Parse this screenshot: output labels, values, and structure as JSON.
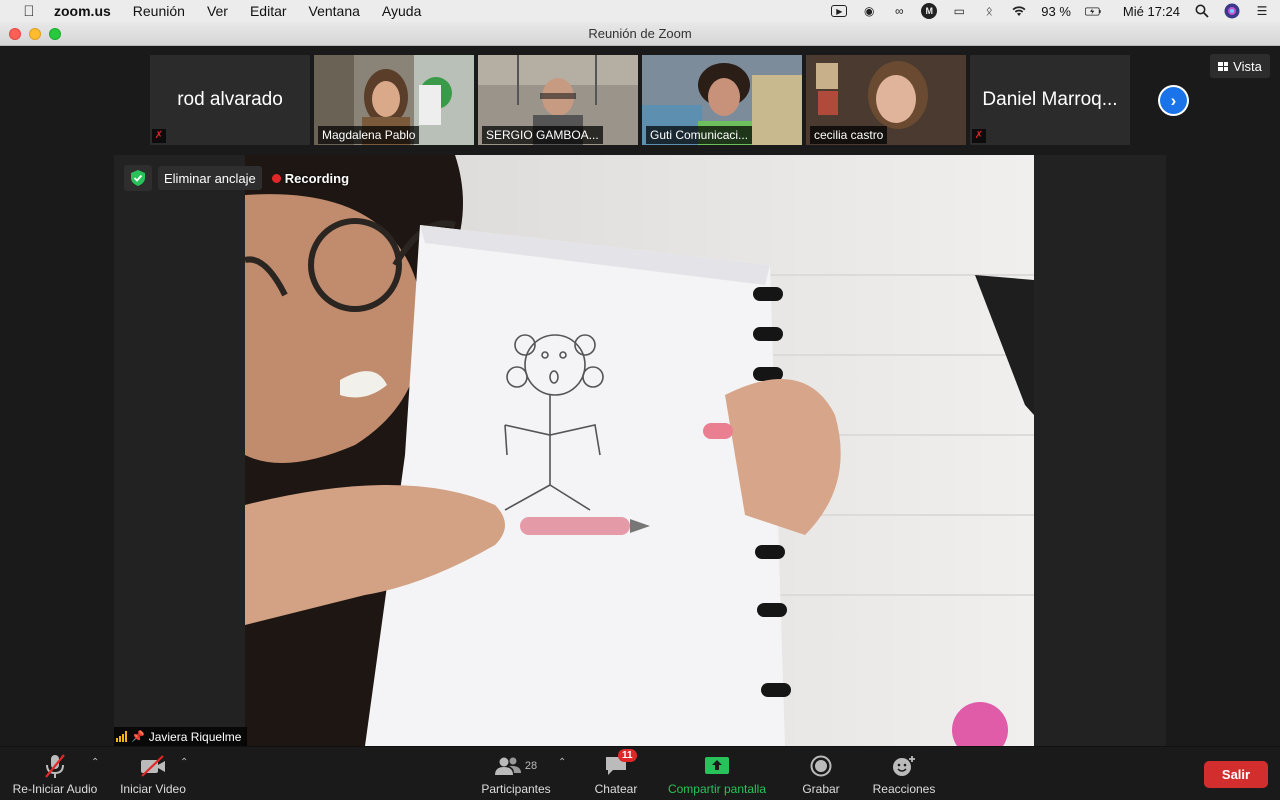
{
  "menubar": {
    "app_name": "zoom.us",
    "items": [
      "Reunión",
      "Ver",
      "Editar",
      "Ventana",
      "Ayuda"
    ],
    "battery": "93 %",
    "clock": "Mié 17:24"
  },
  "window": {
    "title": "Reunión de Zoom"
  },
  "gallery": {
    "participants": [
      {
        "name": "rod alvarado",
        "has_video": false,
        "muted": true
      },
      {
        "name": "Magdalena Pablo",
        "has_video": true,
        "muted": false
      },
      {
        "name": "SERGIO GAMBOA...",
        "has_video": true,
        "muted": false
      },
      {
        "name": "Guti Comunicaci...",
        "has_video": true,
        "muted": false
      },
      {
        "name": "cecilia castro",
        "has_video": true,
        "muted": false
      },
      {
        "name": "Daniel Marroq...",
        "has_video": false,
        "muted": true
      }
    ],
    "view_label": "Vista"
  },
  "main": {
    "unpin_label": "Eliminar anclaje",
    "recording_label": "Recording",
    "speaker_name": "Javiera Riquelme"
  },
  "toolbar": {
    "audio_label": "Re-Iniciar Audio",
    "video_label": "Iniciar Video",
    "participants_label": "Participantes",
    "participants_count": "28",
    "chat_label": "Chatear",
    "chat_badge": "11",
    "share_label": "Compartir pantalla",
    "record_label": "Grabar",
    "reactions_label": "Reacciones",
    "leave_label": "Salir"
  },
  "colors": {
    "accent_blue": "#1a73e8",
    "share_green": "#27c35a",
    "leave_red": "#d22e2e",
    "recording_red": "#e02828"
  }
}
